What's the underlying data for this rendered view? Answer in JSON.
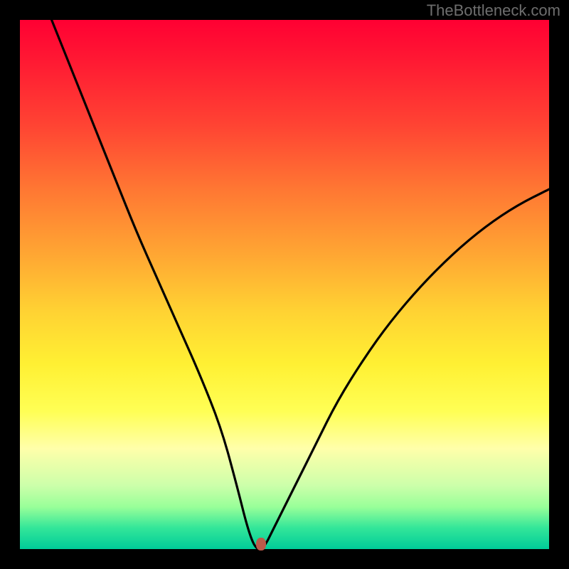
{
  "watermark": "TheBottleneck.com",
  "marker": {
    "x_pct": 45.5,
    "y_pct": 99.0
  },
  "chart_data": {
    "type": "line",
    "title": "",
    "xlabel": "",
    "ylabel": "",
    "xlim": [
      0,
      100
    ],
    "ylim": [
      0,
      100
    ],
    "series": [
      {
        "name": "bottleneck-curve",
        "x": [
          6,
          10,
          14,
          18,
          22,
          26,
          30,
          34,
          38,
          41,
          43,
          44.5,
          46,
          48,
          52,
          56,
          60,
          65,
          70,
          76,
          82,
          88,
          94,
          100
        ],
        "y": [
          100,
          90,
          80,
          70,
          60,
          51,
          42,
          33,
          23,
          12,
          4,
          0,
          0,
          4,
          12,
          20,
          28,
          36,
          43,
          50,
          56,
          61,
          65,
          68
        ]
      }
    ],
    "marker_point": {
      "x": 45.5,
      "y": 0
    },
    "gradient_stops": [
      {
        "pct": 0,
        "color": "#ff0033"
      },
      {
        "pct": 20,
        "color": "#ff4433"
      },
      {
        "pct": 45,
        "color": "#ffa933"
      },
      {
        "pct": 65,
        "color": "#fff033"
      },
      {
        "pct": 81,
        "color": "#ffffaa"
      },
      {
        "pct": 92,
        "color": "#99ff99"
      },
      {
        "pct": 100,
        "color": "#00cc99"
      }
    ]
  }
}
